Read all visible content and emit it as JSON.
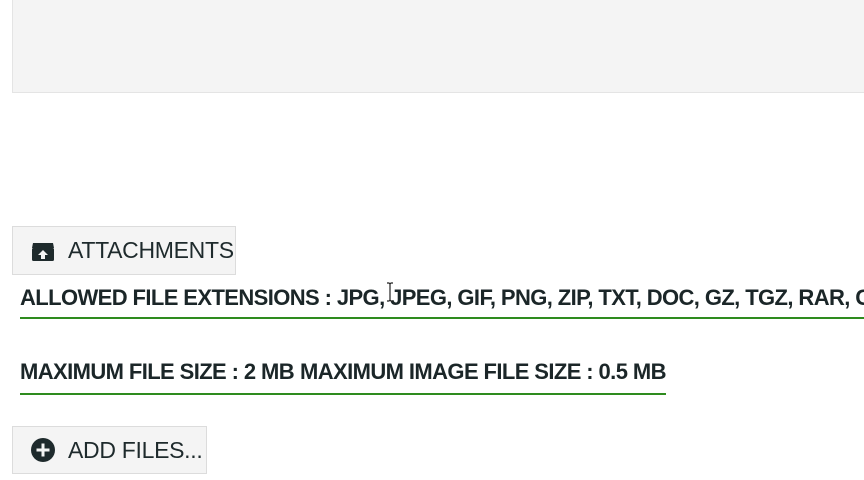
{
  "editor": {
    "text_value": ""
  },
  "attachments": {
    "button_label": "ATTACHMENTS",
    "icon": "archive-box-icon",
    "allowed_extensions_text": "ALLOWED FILE EXTENSIONS : JPG, JPEG, GIF, PNG, ZIP, TXT, DOC, GZ, TGZ, RAR, CSV",
    "max_file_size_text": "MAXIMUM FILE SIZE : 2 MB",
    "max_image_size_text": "MAXIMUM IMAGE FILE SIZE : 0.5 MB",
    "add_files_label": "ADD FILES...",
    "add_icon": "plus-circle-icon"
  },
  "colors": {
    "underline": "#2e8b1e",
    "text": "#1b2628",
    "button_bg": "#f4f4f4"
  }
}
